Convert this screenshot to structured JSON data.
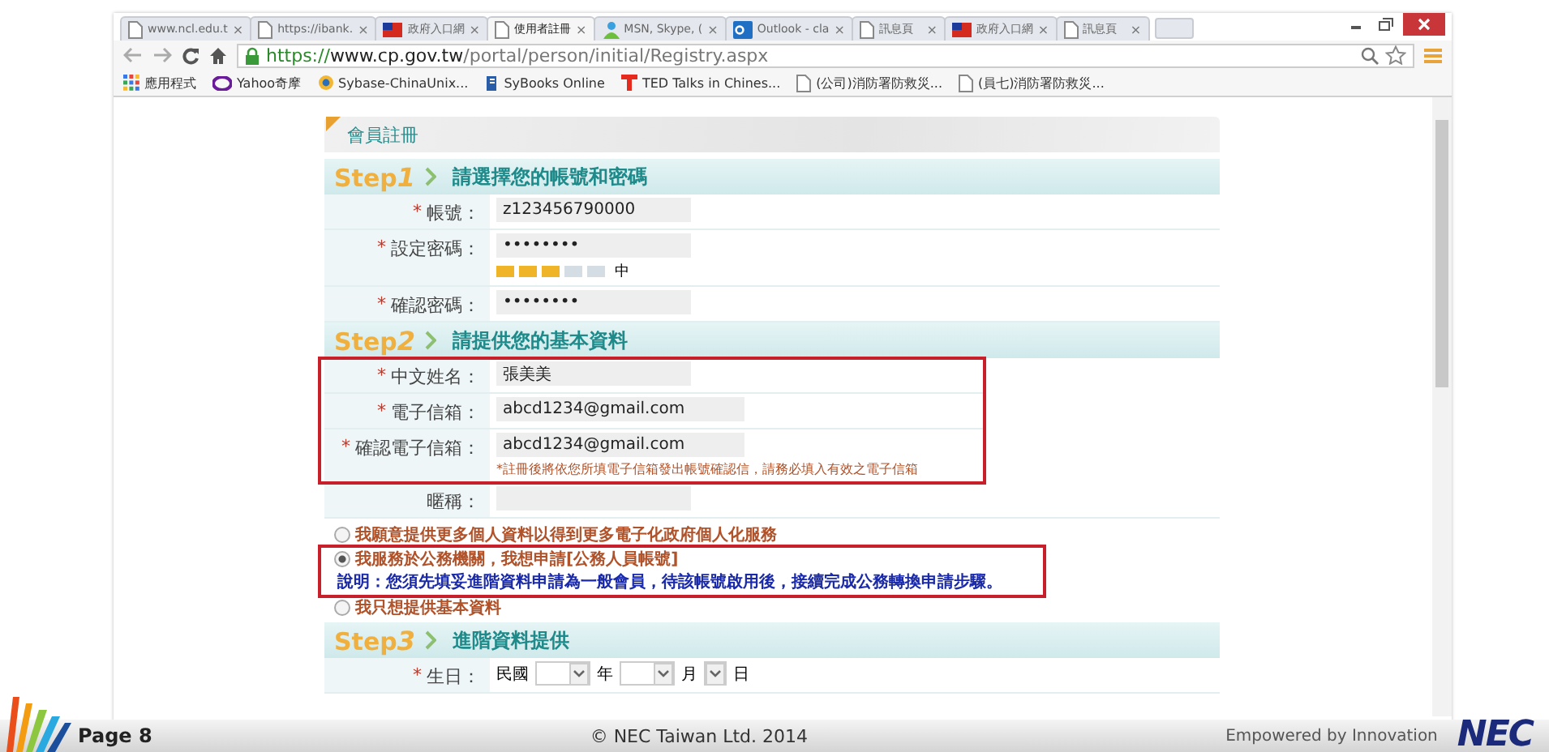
{
  "browser": {
    "tabs": [
      {
        "label": "www.ncl.edu.t",
        "kind": "page",
        "selected": false
      },
      {
        "label": "https://ibank.",
        "kind": "page",
        "selected": false
      },
      {
        "label": "政府入口網",
        "kind": "flag",
        "selected": false
      },
      {
        "label": "使用者註冊",
        "kind": "page",
        "selected": true
      },
      {
        "label": "MSN, Skype, (",
        "kind": "person",
        "selected": false
      },
      {
        "label": "Outlook - cla",
        "kind": "app",
        "selected": false
      },
      {
        "label": "訊息頁",
        "kind": "page",
        "selected": false
      },
      {
        "label": "政府入口網",
        "kind": "flag",
        "selected": false
      },
      {
        "label": "訊息頁",
        "kind": "page",
        "selected": false
      }
    ],
    "tab_close": "×",
    "address_scheme": "https://",
    "address_host": "www.cp.gov.tw",
    "address_path": "/portal/person/initial/Registry.aspx",
    "bookmarks": [
      {
        "label": "應用程式",
        "kind": "grid"
      },
      {
        "label": "Yahoo奇摩",
        "kind": "yahoo"
      },
      {
        "label": "Sybase-ChinaUnix...",
        "kind": "globe"
      },
      {
        "label": "SyBooks Online",
        "kind": "book"
      },
      {
        "label": "TED Talks in Chines...",
        "kind": "ted"
      },
      {
        "label": "(公司)消防署防救災...",
        "kind": "page"
      },
      {
        "label": "(員七)消防署防救災...",
        "kind": "page"
      }
    ]
  },
  "form": {
    "title": "會員註冊",
    "sections": [
      {
        "step": "Step",
        "number": "1",
        "title": "請選擇您的帳號和密碼",
        "groups": [
          {
            "highlighted": false,
            "rows": [
              {
                "kind": "text",
                "mark": "*",
                "label": "帳號：",
                "value": "z123456790000"
              },
              {
                "kind": "password",
                "mark": "*",
                "label": "設定密碼：",
                "value": "••••••••",
                "level": 0.6,
                "strength_label": "中"
              },
              {
                "kind": "text",
                "mark": "*",
                "label": "確認密碼：",
                "value": "••••••••"
              }
            ]
          }
        ]
      },
      {
        "step": "Step",
        "number": "2",
        "title": "請提供您的基本資料",
        "groups": [
          {
            "highlighted": true,
            "rows": [
              {
                "kind": "text",
                "mark": "*",
                "label": "中文姓名：",
                "value": "張美美"
              },
              {
                "kind": "email",
                "mark": "*",
                "label": "電子信箱：",
                "value": "abcd1234@gmail.com"
              },
              {
                "kind": "email",
                "mark": "*",
                "label": "確認電子信箱：",
                "value": "abcd1234@gmail.com",
                "note": "*註冊後將依您所填電子信箱發出帳號確認信，請務必填入有效之電子信箱"
              }
            ]
          },
          {
            "highlighted": false,
            "rows": [
              {
                "kind": "text",
                "label": "暱稱："
              }
            ]
          }
        ],
        "radios": [
          {
            "label": "我願意提供更多個人資料以得到更多電子化政府個人化服務",
            "selected": false,
            "highlighted": false
          },
          {
            "label": "我服務於公務機關，我想申請[公務人員帳號]",
            "selected": true,
            "highlighted": true,
            "note": "說明：您須先填妥進階資料申請為一般會員，待該帳號啟用後，接續完成公務轉換申請步驟。"
          },
          {
            "label": "我只想提供基本資料",
            "selected": false,
            "highlighted": false
          }
        ]
      },
      {
        "step": "Step",
        "number": "3",
        "title": "進階資料提供",
        "groups": [
          {
            "highlighted": false,
            "rows": [
              {
                "kind": "date",
                "mark": "*",
                "label": "生日：",
                "prefix": "民國",
                "units": [
                  "年",
                  "月",
                  "日"
                ]
              }
            ]
          }
        ]
      }
    ]
  },
  "footer": {
    "page": "Page 8",
    "copyright": "© NEC Taiwan Ltd. 2014",
    "tagline": "Empowered by Innovation",
    "logo": "NEC"
  }
}
